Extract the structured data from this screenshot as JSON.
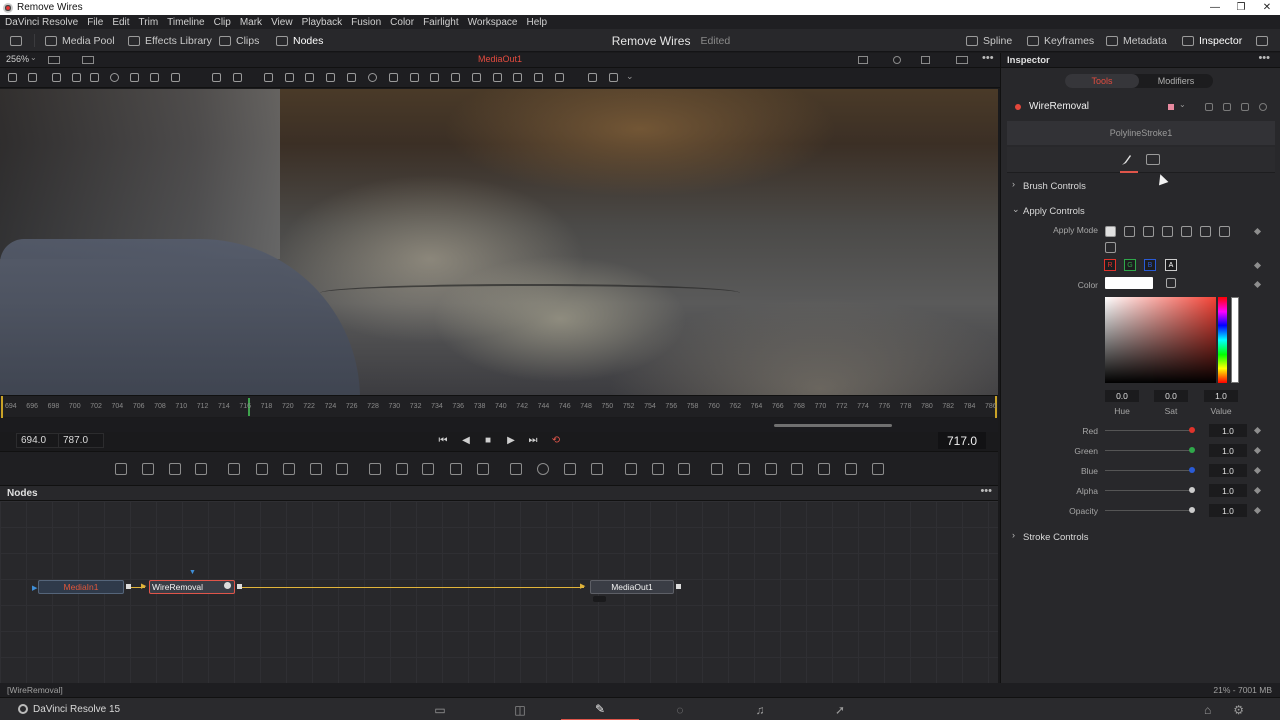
{
  "window": {
    "title": "Remove Wires",
    "controls": [
      "—",
      "❐",
      "✕"
    ]
  },
  "menu": [
    "DaVinci Resolve",
    "File",
    "Edit",
    "Trim",
    "Timeline",
    "Clip",
    "Mark",
    "View",
    "Playback",
    "Fusion",
    "Color",
    "Fairlight",
    "Workspace",
    "Help"
  ],
  "toolbar": {
    "media_pool": "Media Pool",
    "effects_library": "Effects Library",
    "clips": "Clips",
    "nodes": "Nodes",
    "project_title": "Remove Wires",
    "project_status": "Edited",
    "spline": "Spline",
    "keyframes": "Keyframes",
    "metadata": "Metadata",
    "inspector": "Inspector"
  },
  "viewer": {
    "zoom": "256%",
    "output_name": "MediaOut1",
    "ruler_ticks": [
      "694",
      "696",
      "698",
      "700",
      "702",
      "704",
      "706",
      "708",
      "710",
      "712",
      "714",
      "716",
      "718",
      "720",
      "722",
      "724",
      "726",
      "728",
      "730",
      "732",
      "734",
      "736",
      "738",
      "740",
      "742",
      "744",
      "746",
      "748",
      "750",
      "752",
      "754",
      "756",
      "758",
      "760",
      "762",
      "764",
      "766",
      "768",
      "770",
      "772",
      "774",
      "776",
      "778",
      "780",
      "782",
      "784",
      "786"
    ],
    "in_point": "694.0",
    "out_point": "787.0",
    "current_time": "717.0"
  },
  "nodes_panel": {
    "label": "Nodes",
    "menu": "•••",
    "nodes": {
      "media_in": "MediaIn1",
      "wire_removal": "WireRemoval",
      "media_out": "MediaOut1"
    }
  },
  "inspector": {
    "title": "Inspector",
    "menu": "•••",
    "tabs": {
      "tools": "Tools",
      "modifiers": "Modifiers"
    },
    "tool_name": "WireRemoval",
    "stroke_name": "PolylineStroke1",
    "sections": {
      "brush": "Brush Controls",
      "apply": "Apply Controls",
      "stroke": "Stroke Controls"
    },
    "apply_mode_label": "Apply Mode",
    "color_label": "Color",
    "channels": [
      "R",
      "G",
      "B",
      "A"
    ],
    "hsv": {
      "hue": "0.0",
      "sat": "0.0",
      "value": "1.0",
      "hue_label": "Hue",
      "sat_label": "Sat",
      "value_label": "Value"
    },
    "sliders": [
      {
        "label": "Red",
        "value": "1.0",
        "color": "#e0332b"
      },
      {
        "label": "Green",
        "value": "1.0",
        "color": "#2fa84a"
      },
      {
        "label": "Blue",
        "value": "1.0",
        "color": "#2a5bd6"
      },
      {
        "label": "Alpha",
        "value": "1.0",
        "color": "#cccccc"
      },
      {
        "label": "Opacity",
        "value": "1.0",
        "color": "#cccccc"
      }
    ]
  },
  "status": {
    "left": "[WireRemoval]",
    "right": "21% - 7001 MB"
  },
  "bottom": {
    "app_name": "DaVinci Resolve 15"
  },
  "colors": {
    "accent": "#e0554a",
    "link": "#e1b43a"
  }
}
